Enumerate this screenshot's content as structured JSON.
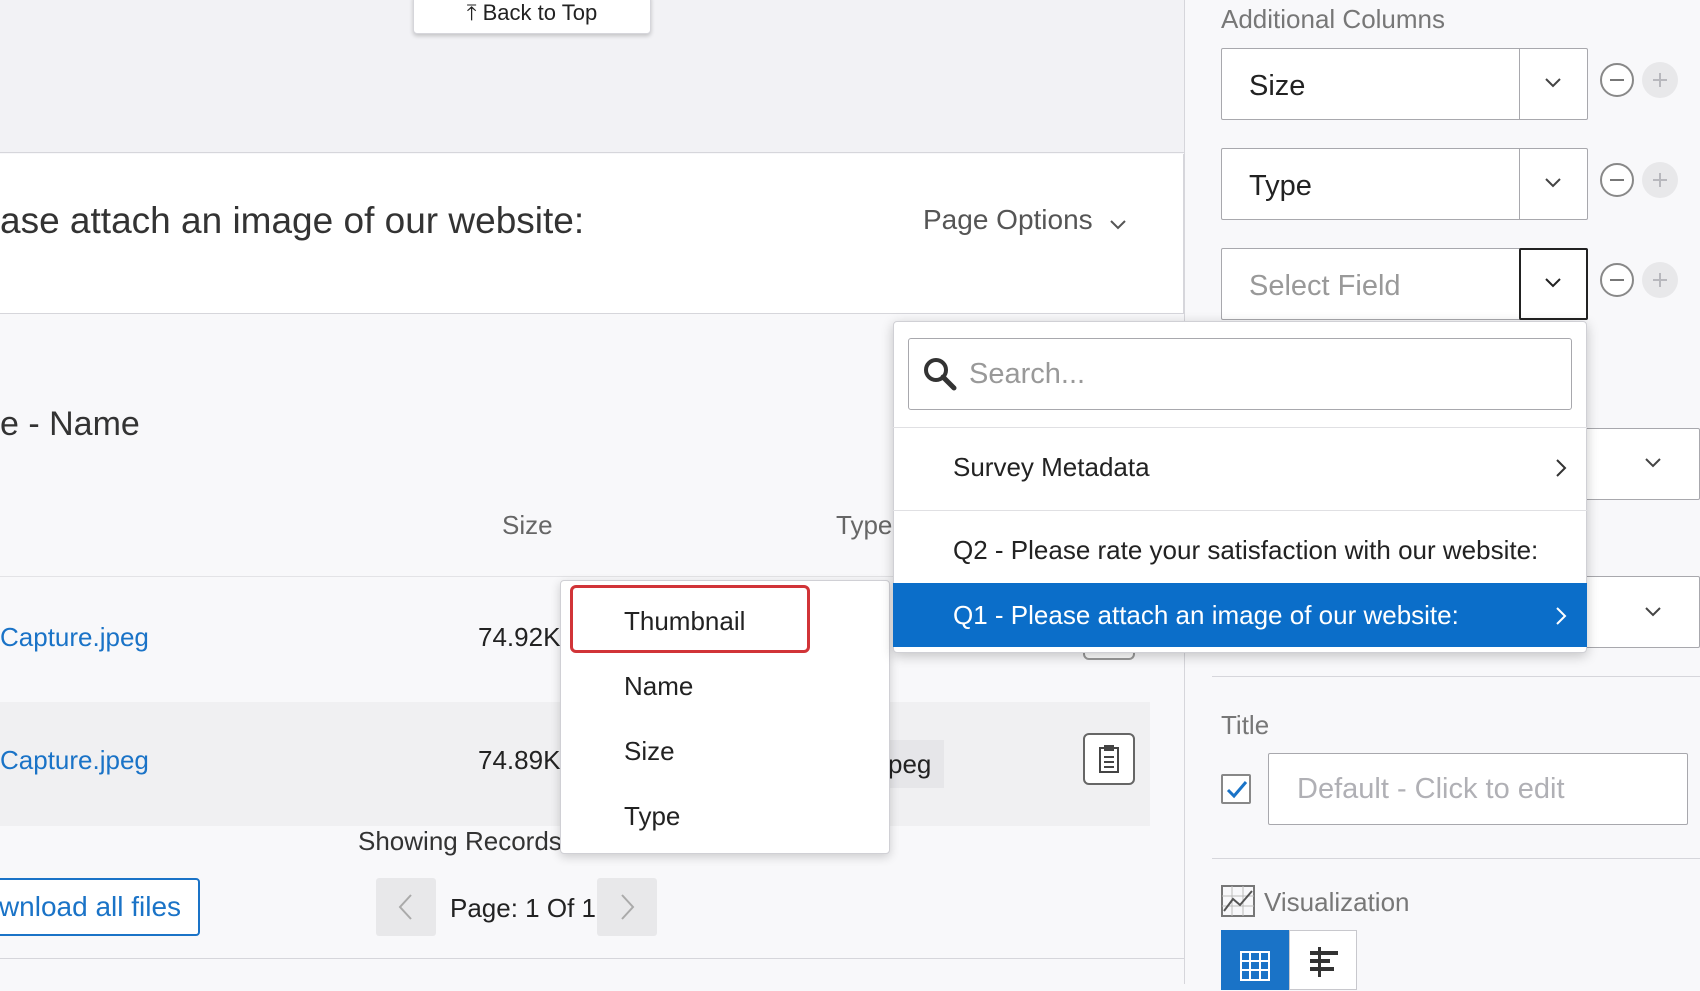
{
  "main": {
    "back_to_top": "⤒ Back to Top",
    "question_title": "ase attach an image of our website:",
    "page_options": "Page Options",
    "widget_title": "e - Name",
    "columns": {
      "size": "Size",
      "type": "Type"
    },
    "rows": [
      {
        "name": "Capture.jpeg",
        "size": "74.92K"
      },
      {
        "name": "Capture.jpeg",
        "size": "74.89K",
        "type": "peg"
      }
    ],
    "showing_records": "Showing Records",
    "download_all": "wnload all files",
    "page_label": "Page: 1 Of 1"
  },
  "column_menu": {
    "items": [
      "Thumbnail",
      "Name",
      "Size",
      "Type"
    ],
    "highlighted": "Thumbnail"
  },
  "panel": {
    "additional_columns_label": "Additional Columns",
    "selects": [
      {
        "value": "Size"
      },
      {
        "value": "Type"
      },
      {
        "placeholder": "Select Field"
      }
    ],
    "title_label": "Title",
    "title_placeholder": "Default - Click to edit",
    "title_checked": true,
    "visualization_label": "Visualization"
  },
  "field_menu": {
    "search_placeholder": "Search...",
    "items": [
      {
        "label": "Survey Metadata",
        "submenu": true
      },
      {
        "label": "Q2 - Please rate your satisfaction with our website:",
        "submenu": false
      },
      {
        "label": "Q1 - Please attach an image of our website:",
        "submenu": true,
        "selected": true
      }
    ]
  },
  "colors": {
    "accent": "#0b6ec9",
    "link": "#1a73c7",
    "highlight_outline": "#d13438"
  }
}
